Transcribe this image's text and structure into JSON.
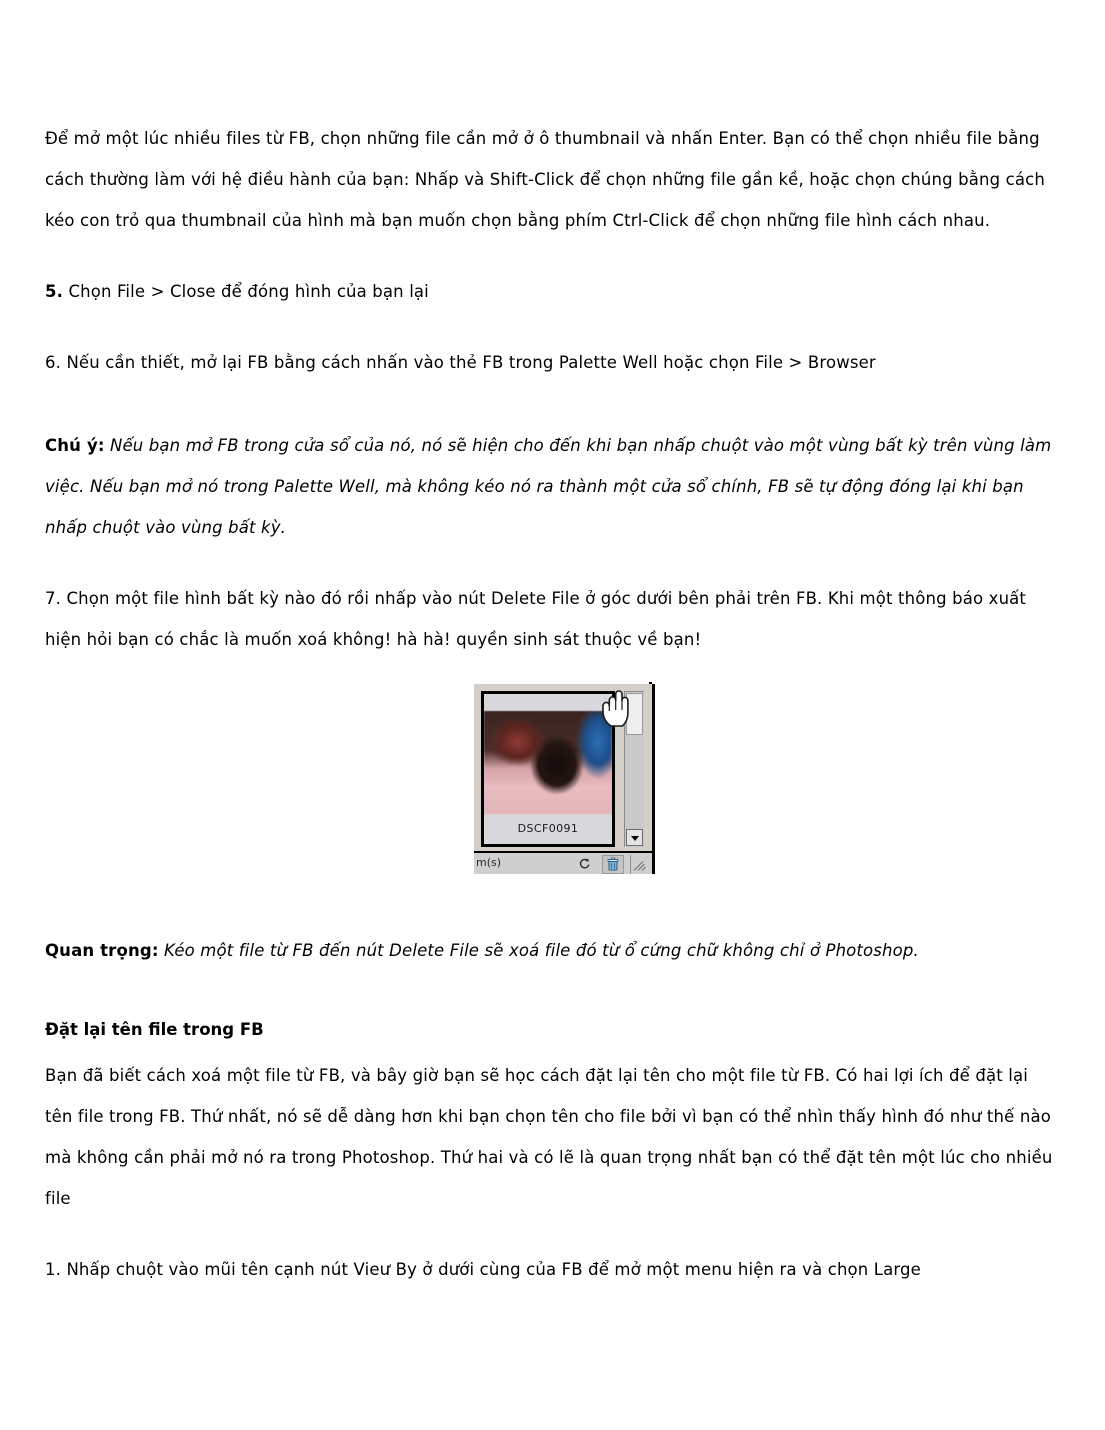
{
  "document": {
    "paragraphs": [
      {
        "id": "p1",
        "text": "Để mở một lúc nhiều files từ FB, chọn những file cần mở ở ô thumbnail và nhấn Enter. Bạn có thể chọn nhiều file bằng cách thường làm với hệ điều hành của bạn: Nhấp và Shift-Click để chọn những file gần kề, hoặc chọn chúng bằng cách kéo con trỏ qua thumbnail của hình mà bạn muốn chọn bằng phím Ctrl-Click để chọn những file hình cách nhau."
      },
      {
        "id": "step5_lead",
        "text": "5."
      },
      {
        "id": "step5_body",
        "text": " Chọn File  >  Close để đóng hình của bạn lại"
      },
      {
        "id": "step6",
        "text": "6. Nếu cần thiết, mở lại FB bằng cách nhấn vào thẻ FB trong Palette Well hoặc chọn File  >  Browser"
      },
      {
        "id": "note_label",
        "text": "Chú ý:"
      },
      {
        "id": "note_body",
        "text": " Nếu bạn mở FB trong cửa sổ của nó, nó sẽ hiện cho đến khi bạn nhấp chuột vào một vùng bất kỳ trên vùng làm việc. Nếu bạn mở nó trong Palette Well, mà không kéo nó ra thành một cửa sổ chính, FB sẽ tự động đóng lại khi bạn nhấp chuột vào vùng bất kỳ."
      },
      {
        "id": "step7",
        "text": "7. Chọn một file hình bất kỳ nào đó rồi nhấp vào nút Delete File ở góc dưới bên phải trên FB. Khi một thông báo xuất hiện hỏi bạn có chắc là muốn xoá không! hà hà! quyền sinh sát thuộc về bạn!"
      },
      {
        "id": "important_label",
        "text": "Quan trọng:"
      },
      {
        "id": "important_body",
        "text": " Kéo một file từ FB đến nút Delete File sẽ xoá file đó từ ổ cứng chữ không chỉ ở Photoshop."
      },
      {
        "id": "heading_rename",
        "text": "Đặt lại tên file trong FB"
      },
      {
        "id": "p_rename_body",
        "text": "Bạn đã biết cách xoá một file từ FB, và bây giờ bạn sẽ học cách đặt lại tên cho một file từ FB. Có hai lợi ích để đặt lại tên file trong FB. Thứ nhất, nó sẽ dễ dàng hơn khi bạn chọn tên cho file bởi vì bạn có thể nhìn thấy hình đó như thế nào mà không cần phải mở nó ra trong Photoshop. Thứ hai và có lẽ là quan trọng nhất bạn có thể đặt tên một lúc cho nhiều file"
      },
      {
        "id": "step1_next",
        "text": "1. Nhấp chuột vào mũi tên cạnh nút Vieư By ở dưới cùng của FB để mở một menu hiện ra và chọn Large"
      }
    ]
  },
  "figure": {
    "caption_alt": "Photoshop File Browser panel screenshot",
    "thumbnail_label": "DSCF0091",
    "toolbar_text": "m(s)",
    "rotate_icon": "rotate-icon",
    "trash_icon": "trash-icon",
    "resize_grip": "resize-grip",
    "scroll_down": "chevron-down-icon",
    "cursor": "hand-cursor"
  },
  "colors": {
    "page_background": "#ffffff",
    "text": "#000000",
    "panel_face": "#d4d0c8",
    "thumb_face": "#d9d9dd",
    "toolbar_face": "#cfcfcf",
    "scroll_track": "#c9c9c9",
    "scroll_thumb": "#eeeeee"
  }
}
